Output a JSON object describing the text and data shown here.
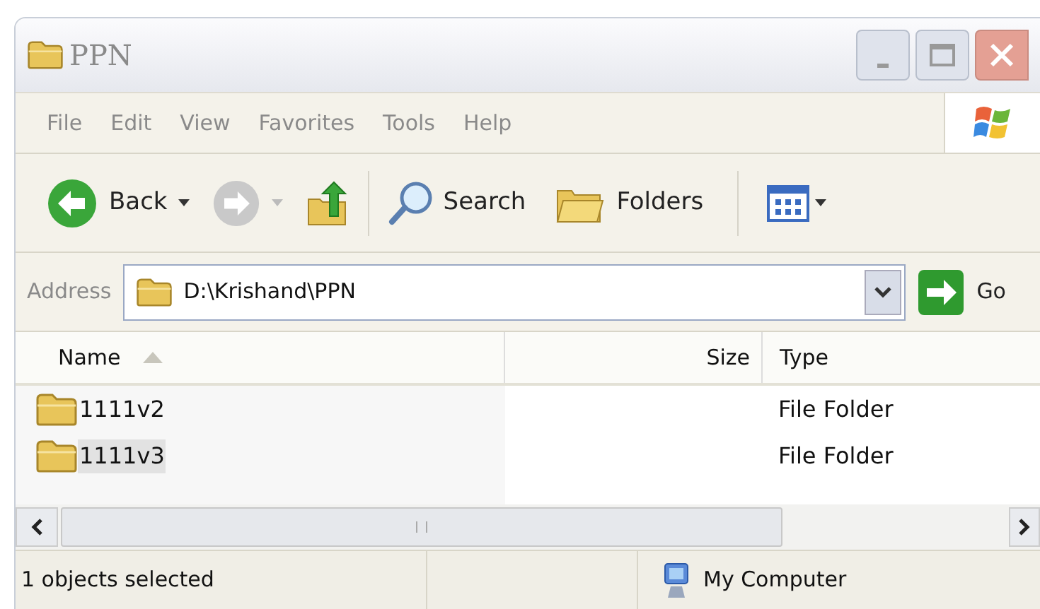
{
  "window": {
    "title": "PPN"
  },
  "menu": [
    "File",
    "Edit",
    "View",
    "Favorites",
    "Tools",
    "Help"
  ],
  "toolbar": [
    {
      "kind": "back",
      "label": "Back",
      "disabled": false
    },
    {
      "kind": "forward",
      "disabled": true
    },
    {
      "kind": "up"
    },
    {
      "kind": "search",
      "label": "Search"
    },
    {
      "kind": "folders",
      "label": "Folders"
    },
    {
      "kind": "views"
    }
  ],
  "address": {
    "label": "Address",
    "value": "D:\\Krishand\\PPN",
    "go": "Go"
  },
  "table": {
    "columns": [
      {
        "label": "Name",
        "sorted": true
      },
      {
        "label": "Size",
        "sorted": false
      },
      {
        "label": "Type",
        "sorted": false
      }
    ],
    "rows": [
      {
        "name": "1111v2",
        "type": "File Folder",
        "selected": false
      },
      {
        "name": "1111v3",
        "type": "File Folder",
        "selected": true
      }
    ]
  },
  "status_bar": {
    "text": "1 objects selected",
    "zone": "My Computer"
  }
}
